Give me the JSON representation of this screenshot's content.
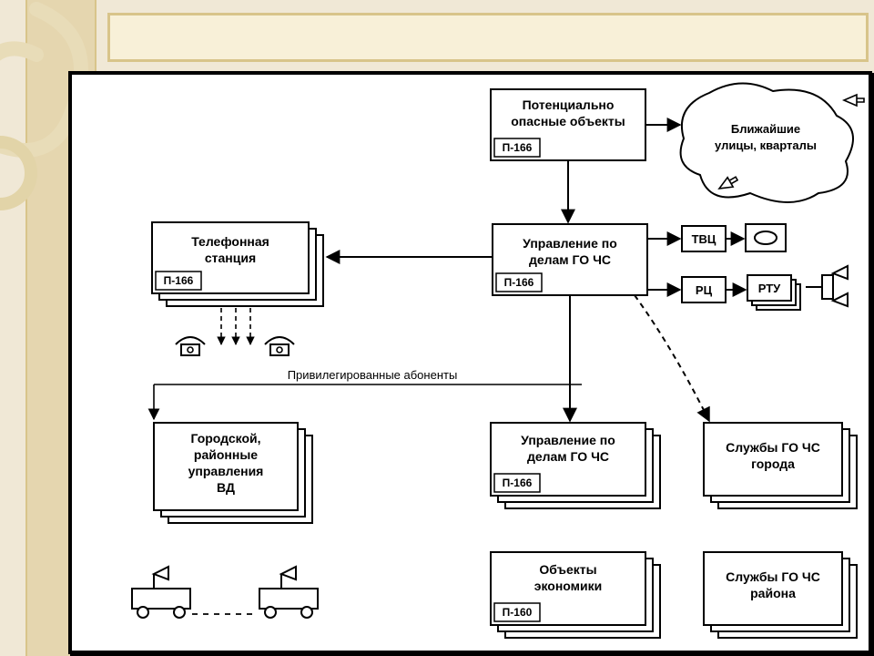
{
  "boxes": {
    "hazard": {
      "line1": "Потенциально",
      "line2": "опасные объекты",
      "tag": "П-166"
    },
    "streets": {
      "line1": "Ближайшие",
      "line2": "улицы, кварталы"
    },
    "telephone": {
      "line1": "Телефонная",
      "line2": "станция",
      "tag": "П-166"
    },
    "go_chs_mgmt": {
      "line1": "Управление по",
      "line2": "делам ГО ЧС",
      "tag": "П-166"
    },
    "tvc": {
      "label": "ТВЦ"
    },
    "rc": {
      "label": "РЦ"
    },
    "rtu": {
      "label": "РТУ"
    },
    "city_vd": {
      "line1": "Городской,",
      "line2": "районные",
      "line3": "управления",
      "line4": "ВД"
    },
    "go_chs_mgmt2": {
      "line1": "Управление по",
      "line2": "делам ГО ЧС",
      "tag": "П-166"
    },
    "services_city": {
      "line1": "Службы ГО ЧС",
      "line2": "города"
    },
    "economy": {
      "line1": "Объекты",
      "line2": "экономики",
      "tag": "П-160"
    },
    "services_dist": {
      "line1": "Службы ГО ЧС",
      "line2": "района"
    }
  },
  "labels": {
    "priv": "Привилегированные абоненты"
  }
}
